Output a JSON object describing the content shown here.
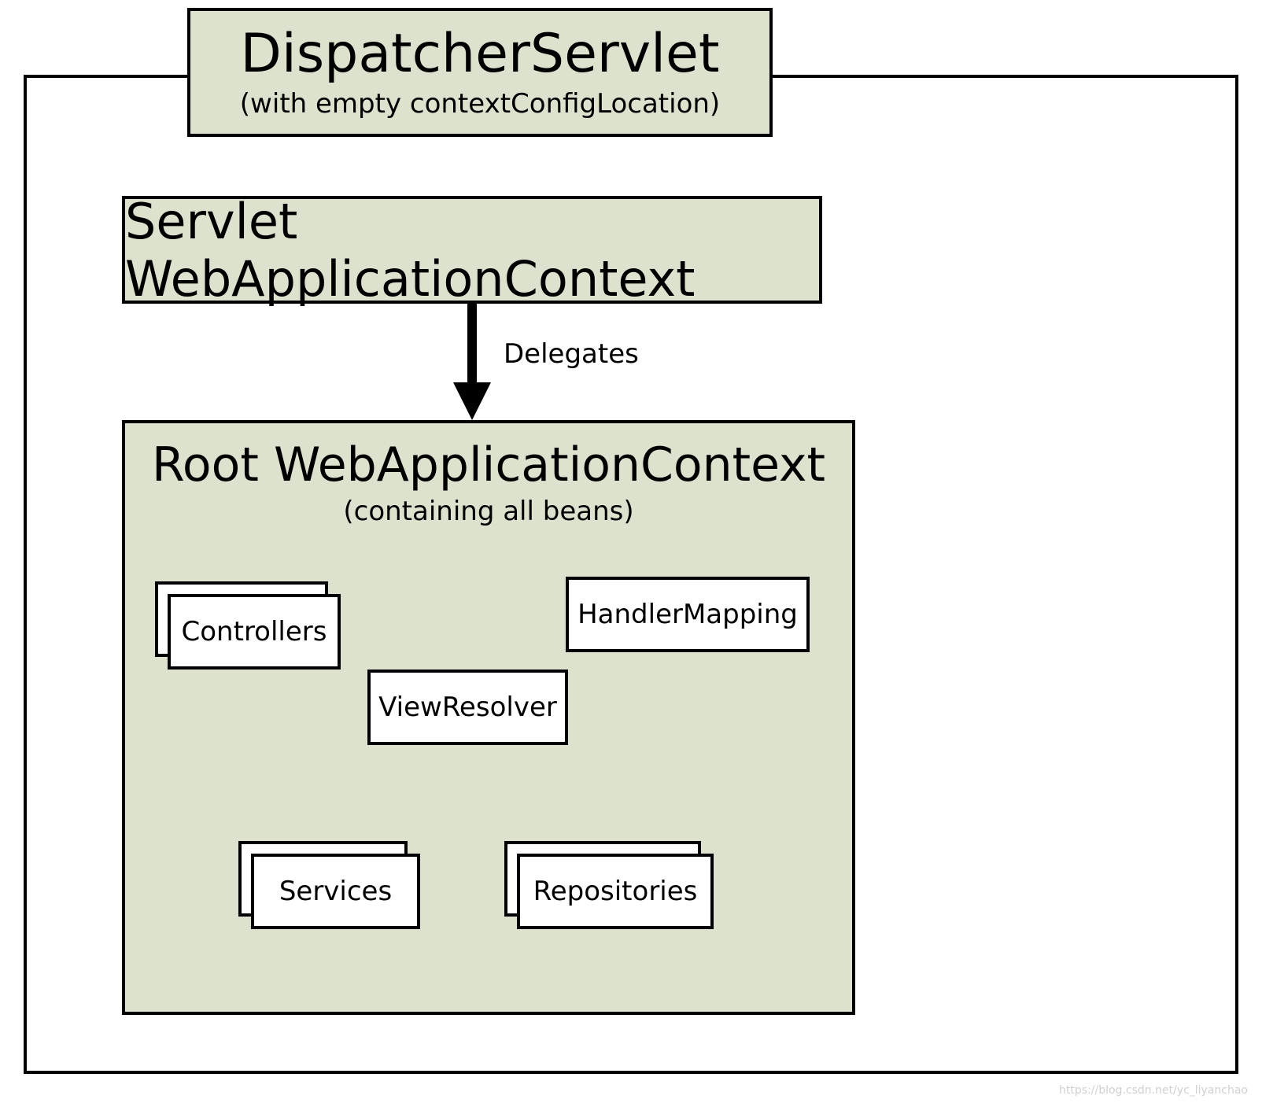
{
  "dispatcher": {
    "title": "DispatcherServlet",
    "subtitle": "(with empty contextConfigLocation)"
  },
  "servlet": {
    "title": "Servlet WebApplicationContext"
  },
  "arrow": {
    "label": "Delegates"
  },
  "root": {
    "title": "Root WebApplicationContext",
    "subtitle": "(containing all beans)",
    "beans": {
      "controllers": "Controllers",
      "handlerMapping": "HandlerMapping",
      "viewResolver": "ViewResolver",
      "services": "Services",
      "repositories": "Repositories"
    }
  },
  "watermark": "https://blog.csdn.net/yc_liyanchao"
}
